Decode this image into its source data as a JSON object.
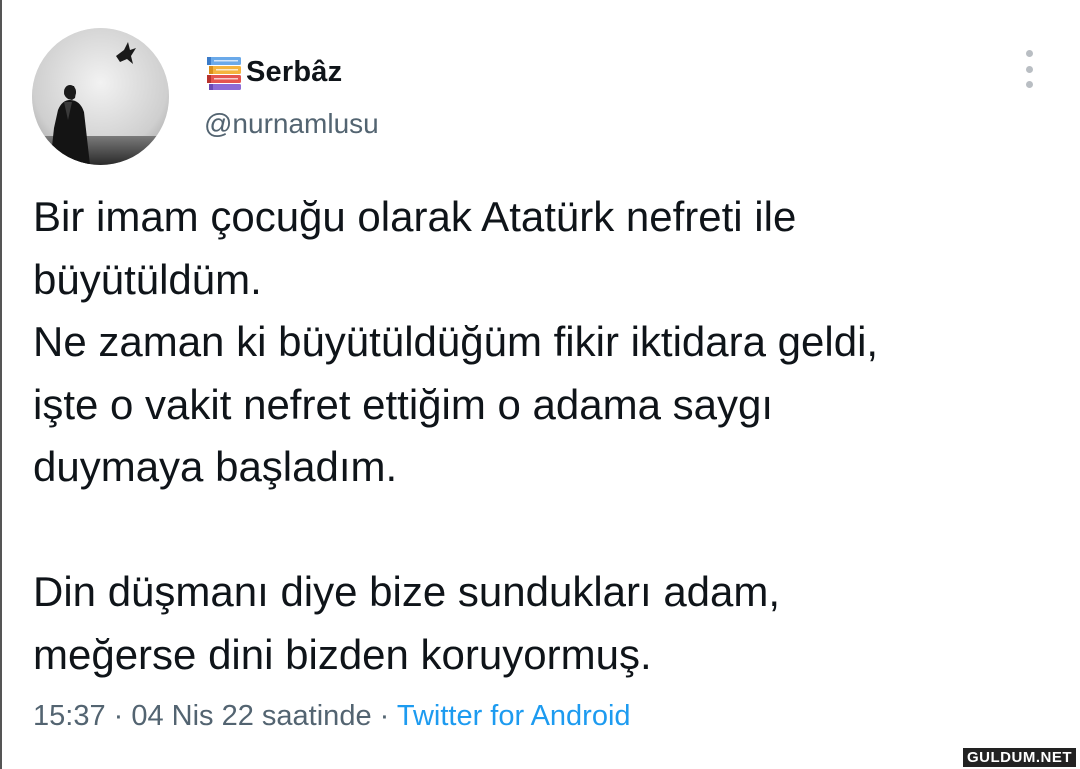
{
  "author": {
    "display_name": "Serbâz",
    "handle": "@nurnamlusu",
    "name_emoji_icon": "books-icon",
    "avatar_icon": "avatar-silhouette-with-bird"
  },
  "tweet": {
    "lines": [
      "Bir imam çocuğu olarak Atatürk nefreti ile",
      "büyütüldüm.",
      "Ne zaman ki büyütüldüğüm fikir iktidara geldi,",
      "işte o vakit nefret ettiğim o adama saygı",
      "duymaya başladım.",
      "",
      "Din düşmanı diye bize sundukları adam,",
      "meğerse dini bizden koruyormuş."
    ]
  },
  "meta": {
    "time": "15:37",
    "separator": " · ",
    "date": "04 Nis 22 saatinde",
    "source": "Twitter for Android"
  },
  "more_icon": "more-vertical-icon",
  "watermark": "GULDUM.NET",
  "colors": {
    "text": "#0f1419",
    "secondary": "#536471",
    "link": "#1d9bf0"
  }
}
